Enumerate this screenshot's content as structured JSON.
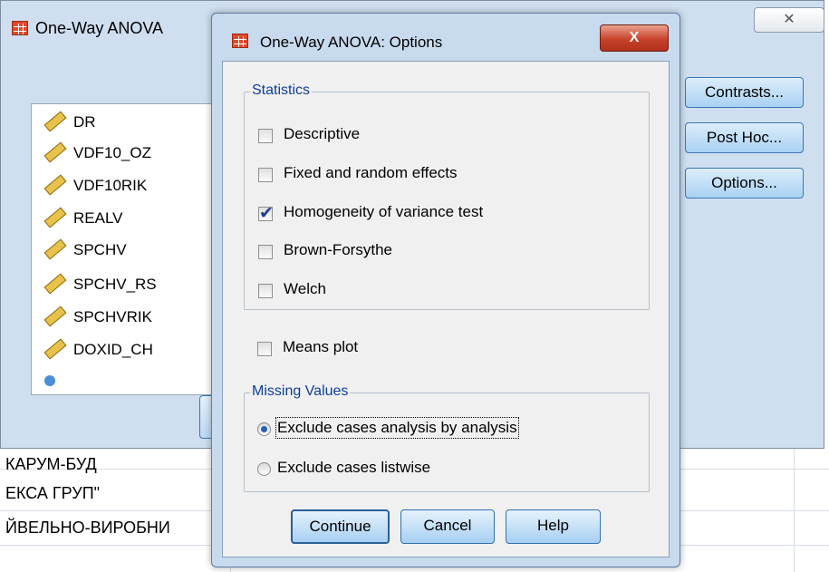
{
  "spreadsheet": {
    "rows": [
      "КАРУМ-БУД",
      "ЕКСА ГРУП\"",
      "ЙВЕЛЬНО-ВИРОБНИ"
    ]
  },
  "parent_dialog": {
    "title": "One-Way ANOVA",
    "close_glyph": "✕",
    "variables": [
      "DR",
      "VDF10_OZ",
      "VDF10RIK",
      "REALV",
      "SPCHV",
      "SPCHV_RS",
      "SPCHVRIK",
      "DOXID_CH"
    ],
    "buttons": {
      "contrasts": "Contrasts...",
      "post_hoc": "Post Hoc...",
      "options": "Options..."
    }
  },
  "options_dialog": {
    "title": "One-Way ANOVA: Options",
    "close_glyph": "X",
    "statistics": {
      "legend": "Statistics",
      "items": [
        {
          "label": "Descriptive",
          "checked": false
        },
        {
          "label": "Fixed and random effects",
          "checked": false
        },
        {
          "label": "Homogeneity of variance test",
          "checked": true
        },
        {
          "label": "Brown-Forsythe",
          "checked": false
        },
        {
          "label": "Welch",
          "checked": false
        }
      ]
    },
    "means_plot": {
      "label": "Means plot",
      "checked": false
    },
    "missing_values": {
      "legend": "Missing Values",
      "options": [
        {
          "label": "Exclude cases analysis by analysis",
          "selected": true
        },
        {
          "label": "Exclude cases listwise",
          "selected": false
        }
      ]
    },
    "buttons": {
      "continue": "Continue",
      "cancel": "Cancel",
      "help": "Help"
    }
  }
}
